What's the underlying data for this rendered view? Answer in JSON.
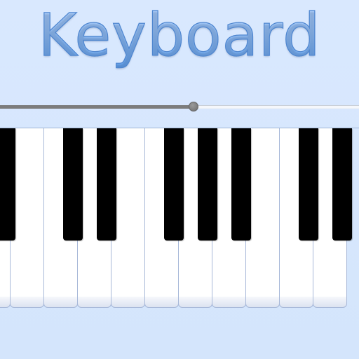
{
  "app": {
    "title": "Keyboard",
    "accent_color": "#62a2ee",
    "background_color": "#d7e7fd"
  },
  "volume_slider": {
    "value_fraction": 0.54,
    "fill_color": "#7c7c7c",
    "track_color": "#f5f7fb"
  },
  "keyboard": {
    "white_key_count": 11,
    "white_key_partial_left": true,
    "white_key_partial_right": true,
    "black_keys_after_white_index": [
      0,
      2,
      3,
      5,
      6,
      7,
      9,
      10
    ]
  }
}
